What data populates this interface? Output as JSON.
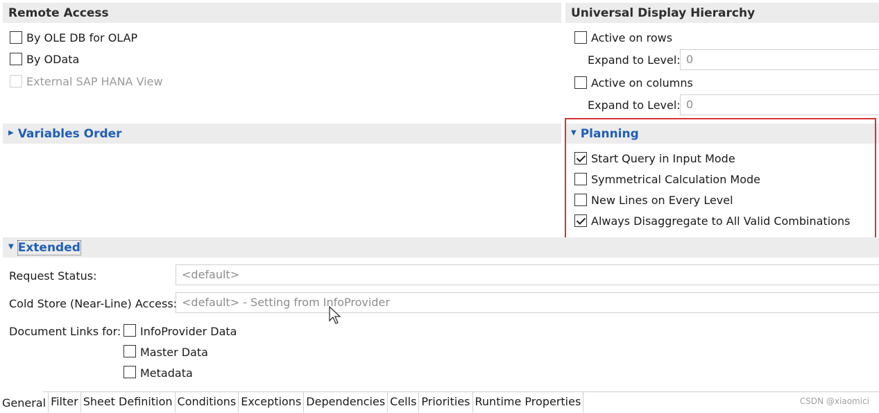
{
  "remote_access": {
    "title": "Remote Access",
    "ole_db": "By OLE DB for OLAP",
    "odata": "By OData",
    "hana_view": "External SAP HANA View"
  },
  "universal_display": {
    "title": "Universal Display Hierarchy",
    "active_rows": "Active on rows",
    "expand_rows_label": "Expand to Level:",
    "expand_rows_value": "0",
    "active_columns": "Active on columns",
    "expand_cols_label": "Expand to Level:",
    "expand_cols_value": "0"
  },
  "variables_order": {
    "title": "Variables Order"
  },
  "planning": {
    "title": "Planning",
    "items": [
      {
        "label": "Start Query in Input Mode",
        "checked": true
      },
      {
        "label": "Symmetrical Calculation Mode",
        "checked": false
      },
      {
        "label": "New Lines on Every Level",
        "checked": false
      },
      {
        "label": "Always Disaggregate to All Valid Combinations",
        "checked": true
      }
    ]
  },
  "extended": {
    "title": "Extended",
    "request_status_label": "Request Status:",
    "request_status_value": "<default>",
    "cold_store_label": "Cold Store (Near-Line) Access:",
    "cold_store_value": "<default> - Setting from InfoProvider",
    "doc_links_label": "Document Links for:",
    "doc_links": [
      "InfoProvider Data",
      "Master Data",
      "Metadata"
    ]
  },
  "tabs": [
    "General",
    "Filter",
    "Sheet Definition",
    "Conditions",
    "Exceptions",
    "Dependencies",
    "Cells",
    "Priorities",
    "Runtime Properties"
  ],
  "watermark": "CSDN @xiaomici",
  "colors": {
    "accent": "#1f5fb8",
    "highlight_border": "#d83030",
    "header_bg": "#ececec"
  }
}
